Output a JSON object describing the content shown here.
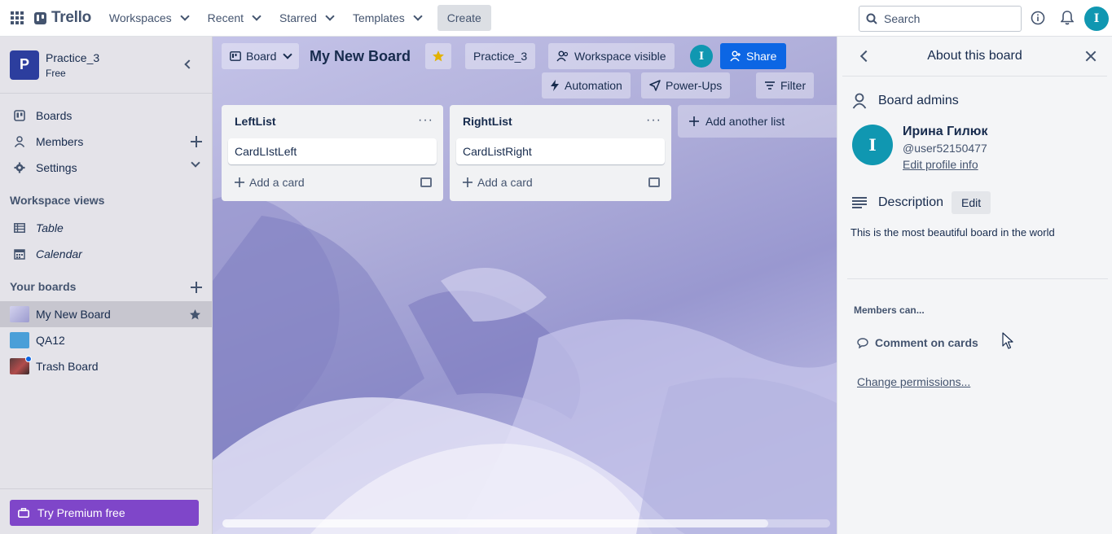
{
  "header": {
    "logo": "Trello",
    "nav": [
      {
        "label": "Workspaces"
      },
      {
        "label": "Recent"
      },
      {
        "label": "Starred"
      },
      {
        "label": "Templates"
      }
    ],
    "create_label": "Create",
    "search_placeholder": "Search",
    "user_initial": "I"
  },
  "sidebar": {
    "workspace_initial": "P",
    "workspace_name": "Practice_3",
    "workspace_plan": "Free",
    "items": [
      {
        "label": "Boards"
      },
      {
        "label": "Members"
      },
      {
        "label": "Settings"
      }
    ],
    "views_heading": "Workspace views",
    "views": [
      {
        "label": "Table"
      },
      {
        "label": "Calendar"
      }
    ],
    "boards_heading": "Your boards",
    "boards": [
      {
        "label": "My New Board",
        "color": "#b8b7dd"
      },
      {
        "label": "QA12",
        "color": "#4aa3df"
      },
      {
        "label": "Trash Board",
        "color": "#7a4a4a"
      }
    ],
    "premium_label": "Try Premium free"
  },
  "board": {
    "view_label": "Board",
    "title": "My New Board",
    "workspace_chip": "Practice_3",
    "visibility": "Workspace visible",
    "member_initial": "I",
    "share_label": "Share",
    "automation_label": "Automation",
    "powerups_label": "Power-Ups",
    "filter_label": "Filter",
    "lists": [
      {
        "title": "LeftList",
        "card": "CardLIstLeft",
        "add_label": "Add a card"
      },
      {
        "title": "RightList",
        "card": "CardListRight",
        "add_label": "Add a card"
      }
    ],
    "add_list_label": "Add another list"
  },
  "panel": {
    "title": "About this board",
    "admins_heading": "Board admins",
    "admin_initial": "I",
    "admin_name": "Ирина Гилюк",
    "admin_username": "@user52150477",
    "edit_profile": "Edit profile info",
    "description_heading": "Description",
    "description_edit": "Edit",
    "description_text": "This is the most beautiful board in the world",
    "members_can": "Members can...",
    "comment_on_cards": "Comment on cards",
    "change_permissions": "Change permissions..."
  }
}
